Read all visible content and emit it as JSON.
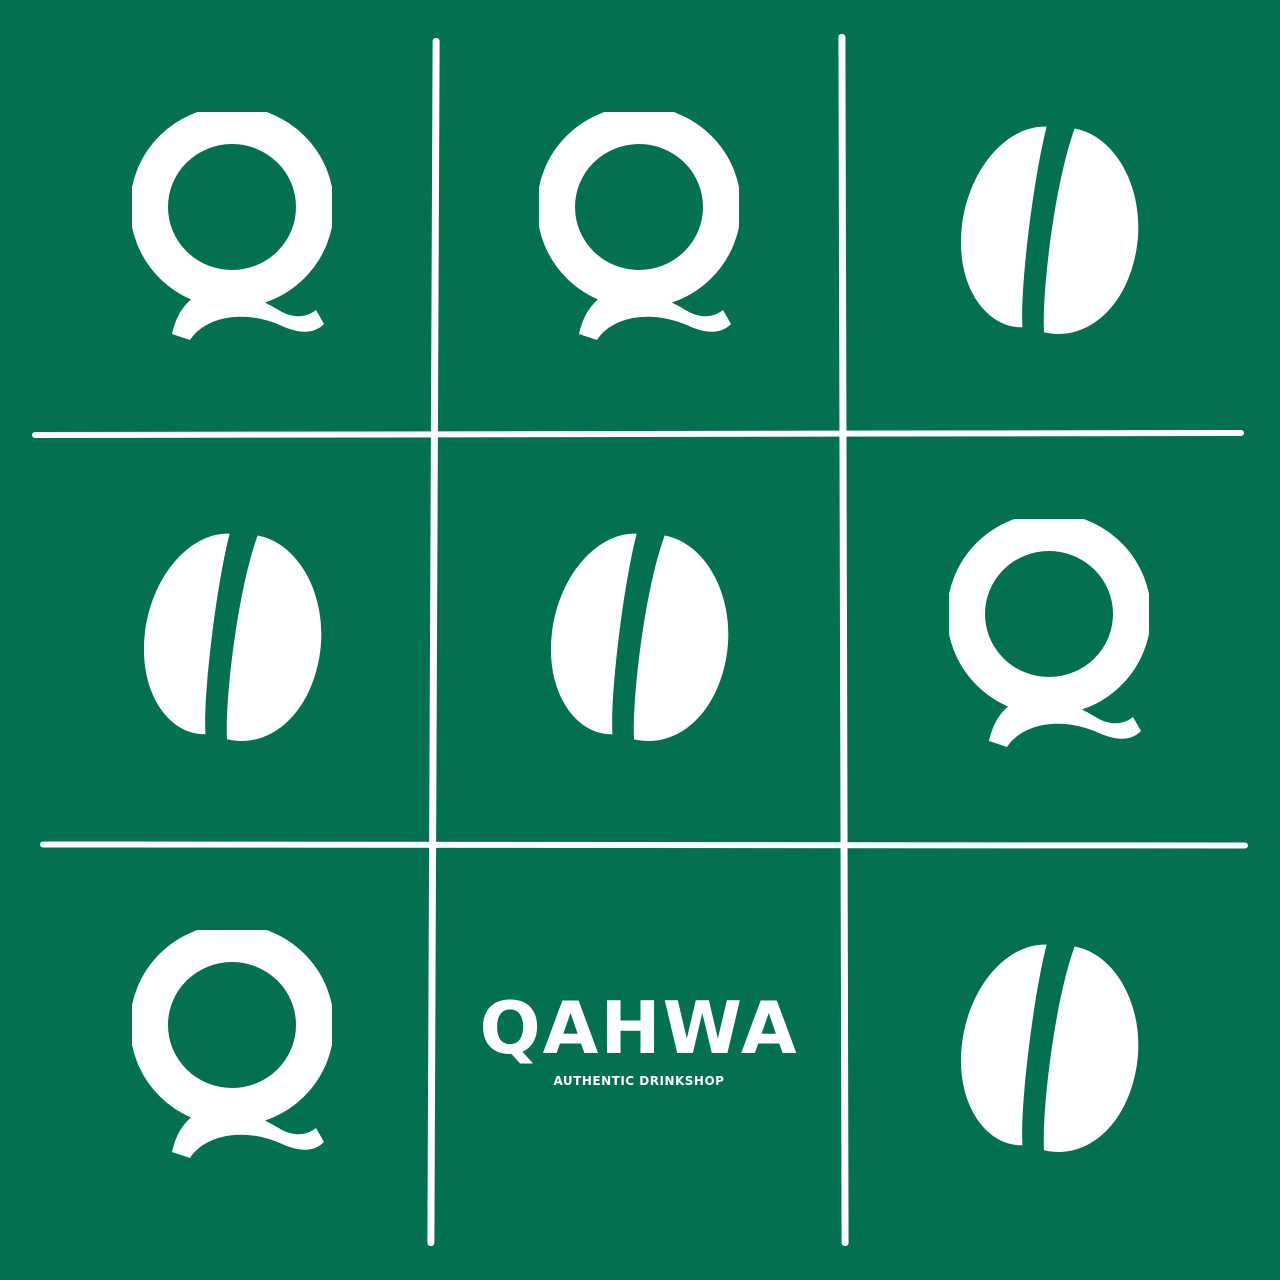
{
  "colors": {
    "background": "#037150",
    "foreground": "#ffffff"
  },
  "board": {
    "cells": [
      {
        "mark": "Q",
        "icon": "q-letter-icon"
      },
      {
        "mark": "Q",
        "icon": "q-letter-icon"
      },
      {
        "mark": "bean",
        "icon": "coffee-bean-icon"
      },
      {
        "mark": "bean",
        "icon": "coffee-bean-icon"
      },
      {
        "mark": "bean",
        "icon": "coffee-bean-icon"
      },
      {
        "mark": "Q",
        "icon": "q-letter-icon"
      },
      {
        "mark": "Q",
        "icon": "q-letter-icon"
      },
      {
        "mark": "logo",
        "icon": "qahwa-logo"
      },
      {
        "mark": "bean",
        "icon": "coffee-bean-icon"
      }
    ]
  },
  "brand": {
    "name": "QAHWA",
    "tagline": "AUTHENTIC DRINKSHOP"
  }
}
